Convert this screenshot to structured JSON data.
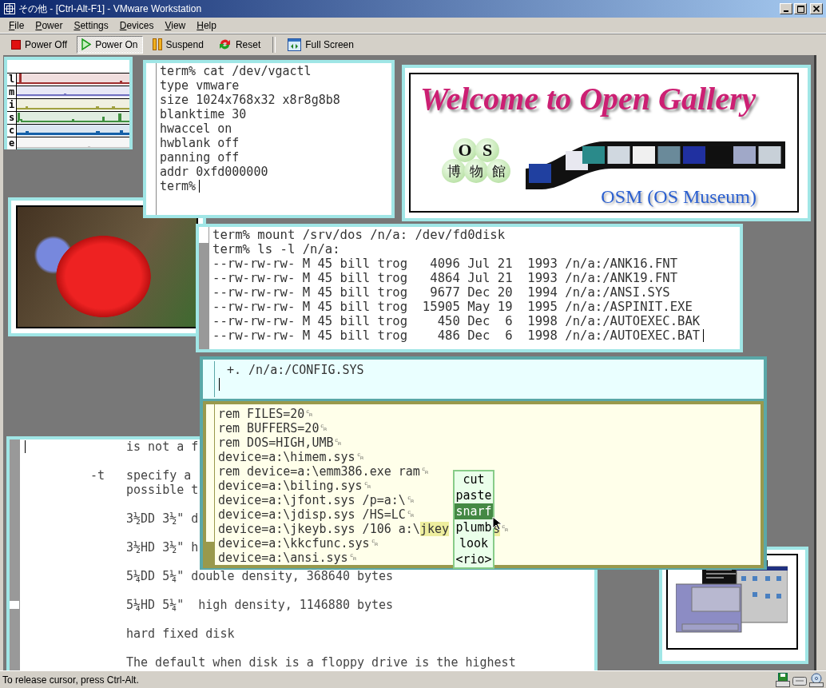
{
  "window": {
    "title": "その他 - [Ctrl-Alt-F1] - VMware Workstation"
  },
  "menu": [
    "File",
    "Power",
    "Settings",
    "Devices",
    "View",
    "Help"
  ],
  "toolbar": [
    {
      "label": "Power Off",
      "kind": "power-off",
      "selected": false,
      "separator_before": false
    },
    {
      "label": "Power On",
      "kind": "power-on",
      "selected": true,
      "separator_before": false
    },
    {
      "label": "Suspend",
      "kind": "suspend",
      "selected": false,
      "separator_before": false
    },
    {
      "label": "Reset",
      "kind": "reset",
      "selected": false,
      "separator_before": false
    },
    {
      "label": "Full Screen",
      "kind": "full-screen",
      "selected": false,
      "separator_before": true
    }
  ],
  "stats": {
    "rows": [
      {
        "label": "l",
        "color": "#a03030"
      },
      {
        "label": "m",
        "color": "#7070c0"
      },
      {
        "label": "i",
        "color": "#a0a040"
      },
      {
        "label": "s",
        "color": "#3f8f3f"
      },
      {
        "label": "c",
        "color": "#1560a8"
      },
      {
        "label": "e",
        "color": "#c8c8c8"
      }
    ]
  },
  "vgactl_terminal": {
    "lines": [
      "term% cat /dev/vgactl",
      "type vmware",
      "size 1024x768x32 x8r8g8b8",
      "blanktime 30",
      "hwaccel on",
      "hwblank off",
      "panning off",
      "addr 0xfd000000",
      "term%"
    ]
  },
  "gallery_banner": {
    "title": "Welcome to Open Gallery",
    "badge_top": [
      "O",
      "S"
    ],
    "badge_bottom": [
      "博",
      "物",
      "館"
    ],
    "caption": "OSM (OS Museum)"
  },
  "ls_terminal": {
    "lines": [
      "term% mount /srv/dos /n/a: /dev/fd0disk",
      "term% ls -l /n/a:",
      "--rw-rw-rw- M 45 bill trog   4096 Jul 21  1993 /n/a:/ANK16.FNT",
      "--rw-rw-rw- M 45 bill trog   4864 Jul 21  1993 /n/a:/ANK19.FNT",
      "--rw-rw-rw- M 45 bill trog   9677 Dec 20  1994 /n/a:/ANSI.SYS",
      "--rw-rw-rw- M 45 bill trog  15905 May 19  1995 /n/a:/ASPINIT.EXE",
      "--rw-rw-rw- M 45 bill trog    450 Dec  6  1998 /n/a:/AUTOEXEC.BAK",
      "--rw-rw-rw- M 45 bill trog    486 Dec  6  1998 /n/a:/AUTOEXEC.BAT"
    ]
  },
  "editor": {
    "tag": "+. /n/a:/CONFIG.SYS",
    "lines": [
      [
        {
          "text": "rem FILES=20␍",
          "selected": false,
          "kind": "text"
        }
      ],
      [
        {
          "text": "rem BUFFERS=20␍",
          "selected": false,
          "kind": "text"
        }
      ],
      [
        {
          "text": "rem DOS=HIGH,UMB␍",
          "selected": false,
          "kind": "text"
        }
      ],
      [
        {
          "text": "device=a:\\himem.sys␍",
          "selected": false,
          "kind": "text"
        }
      ],
      [
        {
          "text": "rem device=a:\\emm386.exe ram␍",
          "selected": false,
          "kind": "text"
        }
      ],
      [
        {
          "text": "device=a:\\biling.sys␍",
          "selected": false,
          "kind": "text"
        }
      ],
      [
        {
          "text": "device=a:\\jfont.sys /p=a:\\␍",
          "selected": false,
          "kind": "text"
        }
      ],
      [
        {
          "text": "device=a:\\jdisp.sys /HS=LC␍",
          "selected": false,
          "kind": "text"
        }
      ],
      [
        {
          "text": "device=a:\\jkeyb.sys /106 a:\\",
          "selected": false,
          "kind": "text"
        },
        {
          "text": "jkey",
          "selected": true,
          "kind": "text"
        },
        {
          "text": "s",
          "selected": true,
          "kind": "after-menu"
        },
        {
          "text": "␍",
          "selected": false,
          "kind": "text"
        }
      ],
      [
        {
          "text": "device=a:\\kkcfunc.sys␍",
          "selected": false,
          "kind": "text"
        }
      ],
      [
        {
          "text": "device=a:\\ansi.sys␍",
          "selected": false,
          "kind": "text"
        }
      ]
    ]
  },
  "context_menu": [
    {
      "label": "cut",
      "selected": false
    },
    {
      "label": "paste",
      "selected": false
    },
    {
      "label": "snarf",
      "selected": true
    },
    {
      "label": "plumb",
      "selected": false
    },
    {
      "label": "look",
      "selected": false
    },
    {
      "label": "<rio>",
      "selected": false
    }
  ],
  "manual": {
    "paragraphs": [
      {
        "lines": [
          "is not a f"
        ]
      },
      {
        "tag": "-t",
        "lines": [
          "specify a",
          "possible t"
        ]
      },
      {
        "lines": [
          "3½DD 3½\" d"
        ]
      },
      {
        "lines": [
          "3½HD 3½\" h"
        ]
      },
      {
        "lines": [
          "5¼DD 5¼\" double density, 368640 bytes"
        ]
      },
      {
        "lines": [
          "5¼HD 5¼\"  high density, 1146880 bytes"
        ]
      },
      {
        "lines": [
          "hard fixed disk"
        ]
      },
      {
        "lines": [
          "The default when disk is a floppy drive is the highest"
        ]
      }
    ]
  },
  "status_bar": {
    "text": "To release cursor, press Ctrl-Alt."
  }
}
